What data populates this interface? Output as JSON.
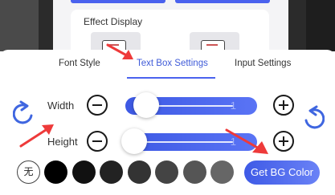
{
  "preview": {
    "effect_title": "Effect Display"
  },
  "tabs": [
    {
      "label": "Font Style",
      "active": false
    },
    {
      "label": "Text Box Settings",
      "active": true
    },
    {
      "label": "Input Settings",
      "active": false
    }
  ],
  "width": {
    "label": "Width",
    "value": "1"
  },
  "height": {
    "label": "Height",
    "value": "1"
  },
  "colors": {
    "accent": "#4a62ee",
    "no_color_label": "无",
    "swatches": [
      "#000000",
      "#111111",
      "#222222",
      "#333333",
      "#444444",
      "#555555",
      "#666666"
    ]
  },
  "bg_color_button": "Get BG Color",
  "icons": [
    "rotate-left-icon",
    "rotate-right-icon",
    "minus-icon",
    "plus-icon",
    "red-arrow-icon"
  ]
}
